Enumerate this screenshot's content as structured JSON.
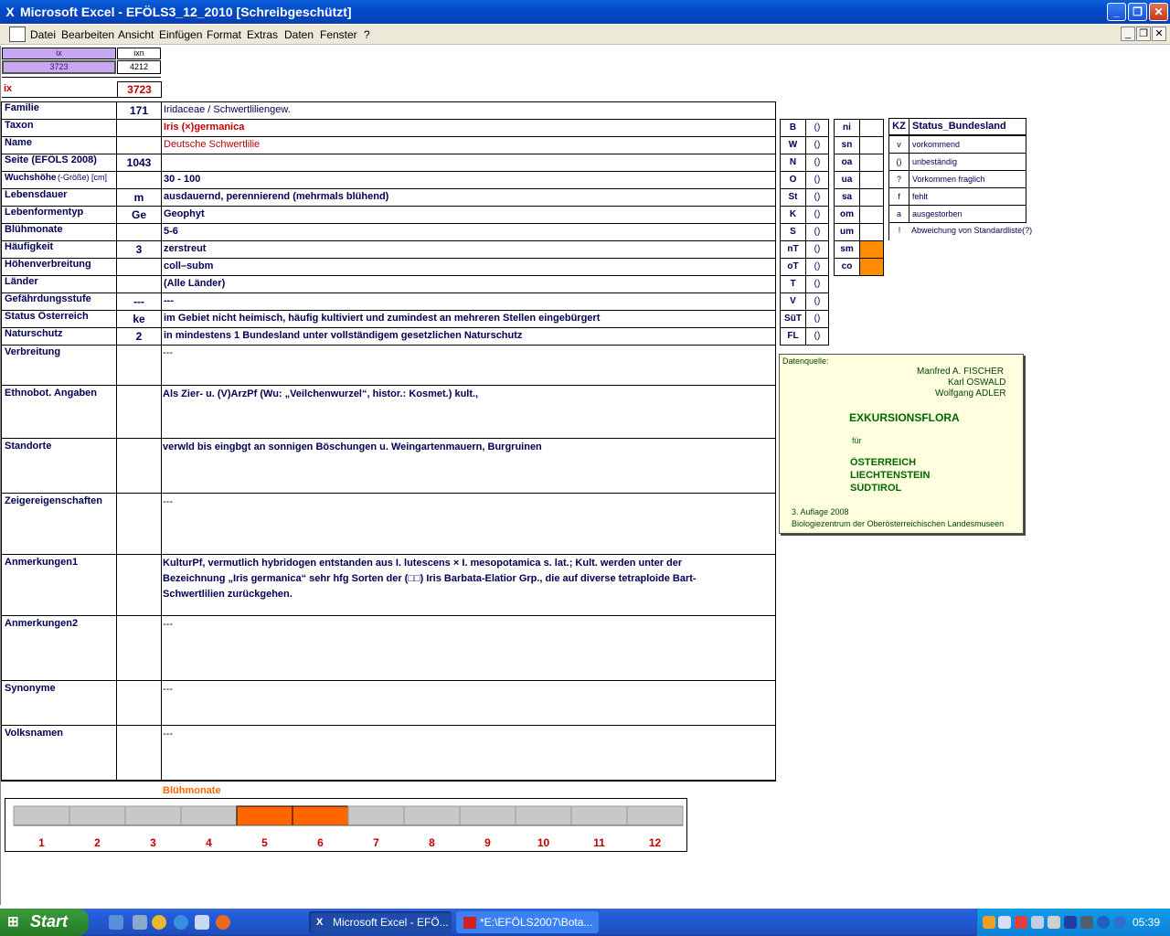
{
  "window": {
    "title": "Microsoft Excel - EFÖLS3_12_2010  [Schreibgeschützt]",
    "btn_min": "_",
    "btn_restore": "❐",
    "btn_close": "✕"
  },
  "menu": {
    "items": [
      "Datei",
      "Bearbeiten",
      "Ansicht",
      "Einfügen",
      "Format",
      "Extras",
      "Daten",
      "Fenster",
      "?"
    ],
    "mdi_min": "_",
    "mdi_restore": "❐",
    "mdi_close": "✕"
  },
  "index_box": {
    "h1": "ix",
    "h2": "ixn",
    "v1": "3723",
    "v2": "4212",
    "ix_label": "ix",
    "ix_value": "3723"
  },
  "fields": [
    {
      "label": "Familie",
      "code": "171",
      "value": "Iridaceae  /  Schwertliliengew."
    },
    {
      "label": "Taxon",
      "code": "",
      "value": "Iris (×)germanica"
    },
    {
      "label": "Name",
      "code": "",
      "value": "Deutsche Schwertlilie"
    },
    {
      "label": "Seite (EFÖLS 2008)",
      "code": "1043",
      "value": ""
    },
    {
      "label": "Wuchshöhe",
      "label_suffix": "(-Größe) [cm]",
      "code": "",
      "value": " 30 - 100"
    },
    {
      "label": "Lebensdauer",
      "code": "m",
      "value": "ausdauernd, perennierend (mehrmals blühend)"
    },
    {
      "label": "Lebenformentyp",
      "code": "Ge",
      "value": "Geophyt"
    },
    {
      "label": "Blühmonate",
      "code": "",
      "value": " 5-6"
    },
    {
      "label": "Häufigkeit",
      "code": "3",
      "value": "zerstreut"
    },
    {
      "label": "Höhenverbreitung",
      "code": "",
      "value": "coll–subm"
    },
    {
      "label": "Länder",
      "code": "",
      "value": "(Alle Länder)"
    },
    {
      "label": "Gefährdungsstufe",
      "code": "---",
      "value": "  ---"
    },
    {
      "label": "Status Österreich",
      "code": "ke",
      "value": "im Gebiet nicht heimisch, häufig kultiviert und zumindest an mehreren Stellen eingebürgert"
    },
    {
      "label": "Naturschutz",
      "code": "2",
      "value": "in mindestens 1 Bundesland unter vollständigem gesetzlichen Naturschutz"
    }
  ],
  "text_fields": [
    {
      "label": "Verbreitung",
      "value": "---"
    },
    {
      "label": "Ethnobot. Angaben",
      "value": "Als Zier- u. (V)ArzPf (Wu: „Veilchenwurzel“, histor.: Kosmet.) kult.,"
    },
    {
      "label": "Standorte",
      "value": "verwld bis eingbgt an sonnigen Böschungen u. Weingartenmauern, Burgruinen"
    },
    {
      "label": "Zeigereigenschaften",
      "value": "---"
    },
    {
      "label": "Anmerkungen1",
      "lines": [
        "KulturPf, vermutlich hybridogen entstanden aus I. lutescens × I. mesopotamica s. lat.; Kult. werden unter der",
        "Bezeichnung „Iris germanica“ sehr hfg Sorten der (□□) Iris Barbata-Elatior Grp., die auf diverse tetraploide Bart-",
        "Schwertlilien zurückgehen."
      ]
    },
    {
      "label": "Anmerkungen2",
      "value": "---"
    },
    {
      "label": "Synonyme",
      "value": "---"
    },
    {
      "label": "Volksnamen",
      "value": "---"
    }
  ],
  "status_left": [
    {
      "code": "B",
      "val": "()"
    },
    {
      "code": "W",
      "val": "()"
    },
    {
      "code": "N",
      "val": "()"
    },
    {
      "code": "O",
      "val": "()"
    },
    {
      "code": "St",
      "val": "()"
    },
    {
      "code": "K",
      "val": "()"
    },
    {
      "code": "S",
      "val": "()"
    },
    {
      "code": "nT",
      "val": "()"
    },
    {
      "code": "oT",
      "val": "()"
    },
    {
      "code": "T",
      "val": "()"
    },
    {
      "code": "V",
      "val": "()"
    },
    {
      "code": "SüT",
      "val": "()"
    },
    {
      "code": "FL",
      "val": "()"
    }
  ],
  "status_mid": [
    {
      "code": "ni",
      "hl": false
    },
    {
      "code": "sn",
      "hl": false
    },
    {
      "code": "oa",
      "hl": false
    },
    {
      "code": "ua",
      "hl": false
    },
    {
      "code": "sa",
      "hl": false
    },
    {
      "code": "om",
      "hl": false
    },
    {
      "code": "um",
      "hl": false
    },
    {
      "code": "sm",
      "hl": true
    },
    {
      "code": "co",
      "hl": true
    }
  ],
  "legend": {
    "header_kz": "KZ",
    "header_title": "Status_Bundesland",
    "rows": [
      {
        "kz": "v",
        "text": "vorkommend"
      },
      {
        "kz": "()",
        "text": "unbeständig"
      },
      {
        "kz": "?",
        "text": "Vorkommen fraglich"
      },
      {
        "kz": "f",
        "text": "fehlt"
      },
      {
        "kz": "a",
        "text": "ausgestorben"
      },
      {
        "kz": "!",
        "text": "Abweichung von Standardliste(?)"
      }
    ]
  },
  "source": {
    "label": "Datenquelle:",
    "authors": [
      "Manfred A. FISCHER",
      "Karl OSWALD",
      "Wolfgang ADLER"
    ],
    "title": "EXKURSIONSFLORA",
    "fuer": "für",
    "regions": [
      "ÖSTERREICH",
      "LIECHTENSTEIN",
      "SÜDTIROL"
    ],
    "edition": "3. Auflage 2008",
    "publisher": "Biologiezentrum der Oberösterreichischen Landesmuseen"
  },
  "bloom": {
    "title": "Blühmonate",
    "months": [
      "1",
      "2",
      "3",
      "4",
      "5",
      "6",
      "7",
      "8",
      "9",
      "10",
      "11",
      "12"
    ],
    "active": [
      5,
      6
    ],
    "active_color": "#ff6600",
    "inactive_color": "#c8c8c8"
  },
  "taskbar": {
    "start": "Start",
    "tasks": [
      "Microsoft Excel - EFÖ...",
      "*E:\\EFÖLS2007\\Bota..."
    ],
    "clock": "05:39"
  }
}
